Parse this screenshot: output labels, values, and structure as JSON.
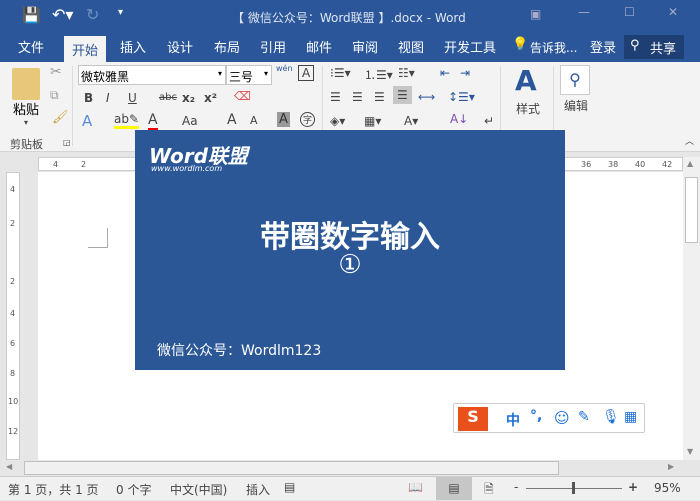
{
  "window": {
    "title": "【 微信公众号：Word联盟 】.docx - Word"
  },
  "tabs": [
    "文件",
    "开始",
    "插入",
    "设计",
    "布局",
    "引用",
    "邮件",
    "审阅",
    "视图",
    "开发工具"
  ],
  "tell_me": "告诉我...",
  "login": "登录",
  "share": "共享",
  "ribbon": {
    "paste": "粘贴",
    "clipboard": "剪贴板",
    "font_name": "微软雅黑",
    "font_size": "三号",
    "styles": "样式",
    "editing": "编辑",
    "bold": "B",
    "italic": "I",
    "underline": "U",
    "strike": "abc",
    "sub": "x₂",
    "sup": "x²",
    "grow": "A",
    "shrink": "A",
    "case": "Aa",
    "wen": "wén"
  },
  "ruler": {
    "top": [
      "4",
      "2",
      "36",
      "38",
      "40",
      "42"
    ],
    "left": [
      "4",
      "2",
      "2",
      "4",
      "6",
      "8",
      "10",
      "12"
    ]
  },
  "overlay": {
    "logo": "Word联盟",
    "logo_url": "www.wordlm.com",
    "headline": "带圈数字输入",
    "symbol": "①",
    "footer": "微信公众号：Wordlm123"
  },
  "ime": {
    "mode": "中",
    "punct": "°,"
  },
  "status": {
    "page": "第 1 页，共 1 页",
    "words": "0 个字",
    "lang": "中文(中国)",
    "insert": "插入",
    "zoom": "95%",
    "minus": "-",
    "plus": "+"
  }
}
